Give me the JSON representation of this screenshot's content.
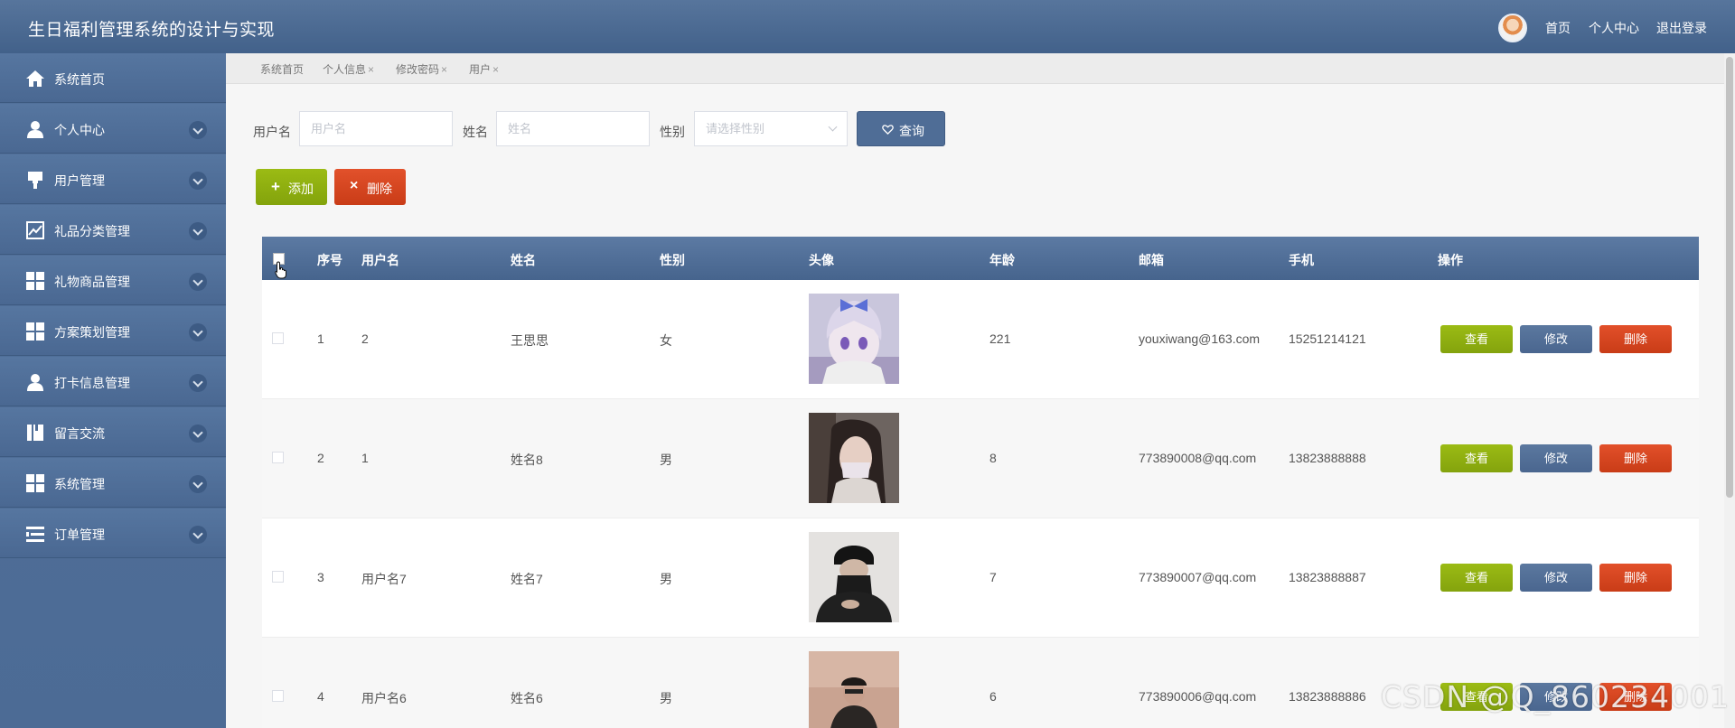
{
  "header": {
    "title": "生日福利管理系统的设计与实现",
    "links": [
      "首页",
      "个人中心",
      "退出登录"
    ]
  },
  "sidebar": {
    "items": [
      {
        "label": "系统首页",
        "icon": "home-icon",
        "expandable": false
      },
      {
        "label": "个人中心",
        "icon": "user-icon",
        "expandable": true
      },
      {
        "label": "用户管理",
        "icon": "brush-icon",
        "expandable": true
      },
      {
        "label": "礼品分类管理",
        "icon": "chart-icon",
        "expandable": true
      },
      {
        "label": "礼物商品管理",
        "icon": "grid-icon",
        "expandable": true
      },
      {
        "label": "方案策划管理",
        "icon": "grid-icon",
        "expandable": true
      },
      {
        "label": "打卡信息管理",
        "icon": "user-icon",
        "expandable": true
      },
      {
        "label": "留言交流",
        "icon": "book-icon",
        "expandable": true
      },
      {
        "label": "系统管理",
        "icon": "grid-icon",
        "expandable": true
      },
      {
        "label": "订单管理",
        "icon": "list-icon",
        "expandable": true
      }
    ]
  },
  "tabs": [
    {
      "label": "系统首页",
      "closable": false
    },
    {
      "label": "个人信息",
      "closable": true
    },
    {
      "label": "修改密码",
      "closable": true
    },
    {
      "label": "用户",
      "closable": true
    }
  ],
  "filters": {
    "username_label": "用户名",
    "username_placeholder": "用户名",
    "name_label": "姓名",
    "name_placeholder": "姓名",
    "gender_label": "性别",
    "gender_placeholder": "请选择性别",
    "query_label": "查询"
  },
  "actions": {
    "add_label": "添加",
    "delete_label": "删除"
  },
  "table": {
    "columns": [
      "序号",
      "用户名",
      "姓名",
      "性别",
      "头像",
      "年龄",
      "邮箱",
      "手机",
      "操作"
    ],
    "rows": [
      {
        "index": "1",
        "username": "2",
        "name": "王思思",
        "gender": "女",
        "age": "221",
        "email": "youxiwang@163.com",
        "phone": "15251214121",
        "avatar": "anime-girl"
      },
      {
        "index": "2",
        "username": "1",
        "name": "姓名8",
        "gender": "男",
        "age": "8",
        "email": "773890008@qq.com",
        "phone": "13823888888",
        "avatar": "selfie-girl"
      },
      {
        "index": "3",
        "username": "用户名7",
        "name": "姓名7",
        "gender": "男",
        "age": "7",
        "email": "773890007@qq.com",
        "phone": "13823888887",
        "avatar": "black-outfit"
      },
      {
        "index": "4",
        "username": "用户名6",
        "name": "姓名6",
        "gender": "男",
        "age": "6",
        "email": "773890006@qq.com",
        "phone": "13823888886",
        "avatar": "sitting-man"
      }
    ],
    "row_actions": {
      "view": "查看",
      "edit": "修改",
      "delete": "删除"
    }
  },
  "watermark": "CSDN @Q_860234001",
  "colors": {
    "header": "#4e6d96",
    "sidebar": "#4f6e98",
    "green": "#8fb010",
    "red": "#d8461f",
    "blue": "#4f6d96"
  }
}
